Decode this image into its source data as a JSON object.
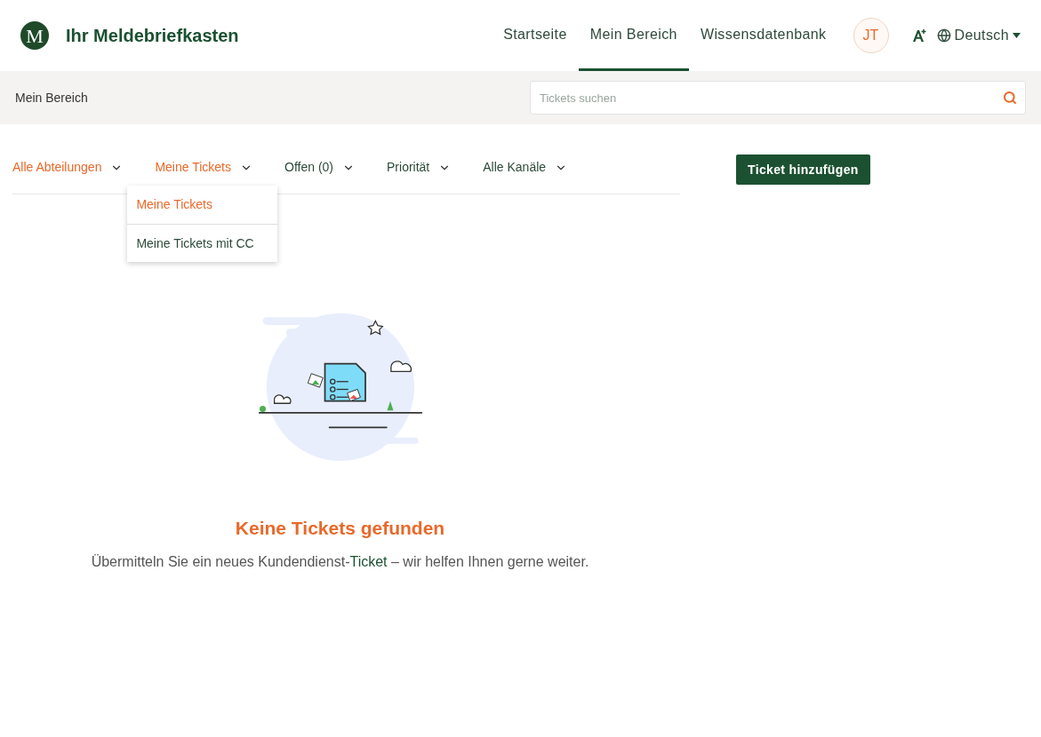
{
  "header": {
    "logo_letter": "M",
    "title": "Ihr Meldebriefkasten",
    "nav": [
      {
        "label": "Startseite",
        "selected": false
      },
      {
        "label": "Mein Bereich",
        "selected": true
      },
      {
        "label": "Wissensdatenbank",
        "selected": false
      }
    ],
    "avatar": "JT",
    "language": "Deutsch"
  },
  "subbar": {
    "breadcrumb": "Mein Bereich",
    "search": {
      "placeholder": "Tickets suchen"
    }
  },
  "filters": [
    {
      "label": "Alle Abteilungen",
      "active": true,
      "expanded": false
    },
    {
      "label": "Meine Tickets",
      "active": true,
      "expanded": true
    },
    {
      "label": "Offen (0)",
      "active": false,
      "expanded": false
    },
    {
      "label": "Priorität",
      "active": false,
      "expanded": false
    },
    {
      "label": "Alle Kanäle",
      "active": false,
      "expanded": false
    }
  ],
  "dropdown": [
    {
      "label": "Meine Tickets",
      "selected": true
    },
    {
      "label": "Meine Tickets mit CC",
      "selected": false
    }
  ],
  "add_button": "Ticket hinzufügen",
  "empty_state": {
    "title": "Keine Tickets gefunden",
    "before": "Übermitteln Sie ein neues Kundendienst-",
    "link": "Ticket",
    "after": " – wir helfen Ihnen gerne weiter."
  }
}
